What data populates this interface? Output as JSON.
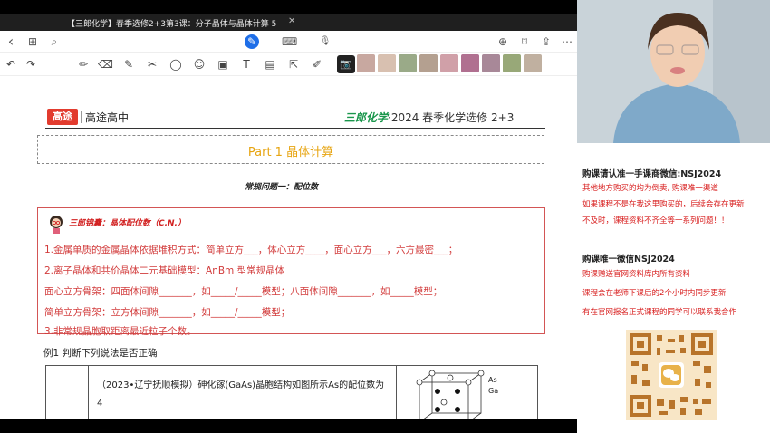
{
  "titlebar": {
    "title": "【三郎化学】春季选修2+3第3课：分子晶体与晶体计算 5",
    "close": "✕"
  },
  "navbar": {
    "back_icon": "‹",
    "grid_icon": "⊞",
    "search_icon": "⌕",
    "pen_icon": "✎",
    "keyboard_icon": "⌨",
    "mic_icon": "🎙",
    "add_page_icon": "⊕",
    "bookmark_icon": "⌑",
    "share_icon": "⇪",
    "more_icon": "⋯"
  },
  "toolbar": {
    "undo_icon": "↶",
    "redo_icon": "↷",
    "tools": [
      "✏",
      "⌫",
      "✎",
      "✂",
      "◯",
      "☺",
      "▣",
      "T",
      "▤",
      "⇱",
      "✐"
    ],
    "camera_icon": "📷",
    "thumb_colors": [
      "#c8a8a0",
      "#d8c0b0",
      "#9aaa88",
      "#b4a090",
      "#d0a0a8",
      "#b07090",
      "#a88898",
      "#98a878",
      "#c0b0a0"
    ]
  },
  "document": {
    "logo_text": "高途",
    "school": "高途高中",
    "course_green": "三郎化学",
    "course_rest": "·2024 春季化学选修 2+3",
    "part_title": "Part 1 晶体计算",
    "subtitle": "常规问题一：配位数",
    "box_title": "三郎锦囊：晶体配位数（C.N.）",
    "rows": [
      "1.金属单质的金属晶体依据堆积方式：简单立方___，体心立方____，面心立方___，六方最密___；",
      "2.离子晶体和共价晶体二元基础模型：AnBm 型常规晶体",
      "   面心立方骨架：四面体间隙_______，如_____/_____模型；八面体间隙_______，如_____模型；",
      "   简单立方骨架：立方体间隙_______，如_____/_____模型；",
      "3.非常规晶胞取距离最近粒子个数。"
    ],
    "example_label": "例1  判断下列说法是否正确",
    "question": "（2023•辽宁抚顺模拟）砷化镓(GaAs)晶胞结构如图所示As的配位数为4",
    "legend_as": "As",
    "legend_ga": "Ga"
  },
  "side": {
    "heading1": "购课请认准一手课商微信:NSJ2024",
    "lines1": [
      "其他地方购买的均为倒卖, 购课唯一渠道",
      "如果课程不是在我这里购买的，后续会存在更新",
      "不及时，课程资料不齐全等一系列问题！！"
    ],
    "heading2": "购课唯一微信NSJ2024",
    "lines2": [
      "购课赠送官网资料库内所有资料",
      "课程会在老师下课后的2个小时内同步更新",
      "有在官网报名正式课程的同学可以联系我合作"
    ]
  }
}
